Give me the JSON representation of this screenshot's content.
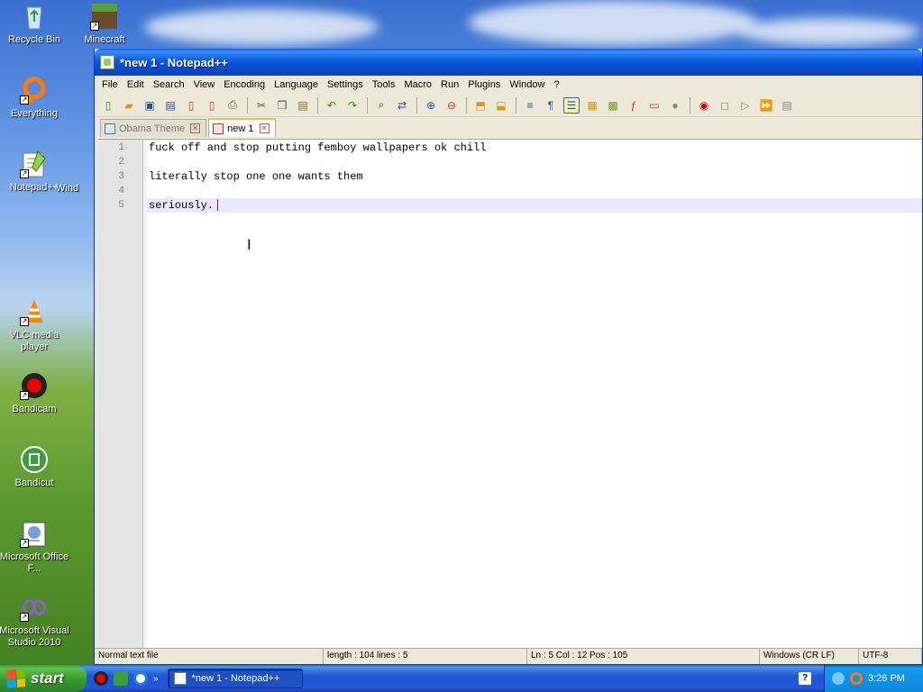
{
  "desktop": {
    "icons": [
      {
        "label": "Recycle Bin"
      },
      {
        "label": "Minecraft"
      },
      {
        "label": "Everything"
      },
      {
        "label": "Notepad++"
      },
      {
        "label": "Wind"
      },
      {
        "label": "VLC media player"
      },
      {
        "label": "Bandicam"
      },
      {
        "label": "Bandicut"
      },
      {
        "label": "Microsoft Office F..."
      },
      {
        "label": "Microsoft Visual Studio 2010"
      }
    ]
  },
  "window": {
    "title": "*new 1 - Notepad++",
    "menu": [
      "File",
      "Edit",
      "Search",
      "View",
      "Encoding",
      "Language",
      "Settings",
      "Tools",
      "Macro",
      "Run",
      "Plugins",
      "Window",
      "?"
    ],
    "tabs": [
      {
        "label": "Obama Theme"
      },
      {
        "label": "new 1"
      }
    ],
    "editor": {
      "line_numbers": [
        "1",
        "2",
        "3",
        "4",
        "5"
      ],
      "lines": [
        "fuck off and stop putting femboy wallpapers ok chill",
        "",
        "literally stop one one wants them",
        "",
        "seriously."
      ]
    },
    "status": {
      "file_type": "Normal text file",
      "length": "length : 104   lines : 5",
      "position": "Ln : 5    Col : 12    Pos : 105",
      "eol": "Windows (CR LF)",
      "encoding": "UTF-8"
    }
  },
  "taskbar": {
    "start_label": "start",
    "task_label": "*new 1 - Notepad++",
    "help": "?",
    "clock": "3:26 PM"
  },
  "colors": {
    "title_blue": "#0a5ae0",
    "start_green": "#379a2f",
    "current_line": "#e8e8ff",
    "caret": "#8000ff"
  }
}
